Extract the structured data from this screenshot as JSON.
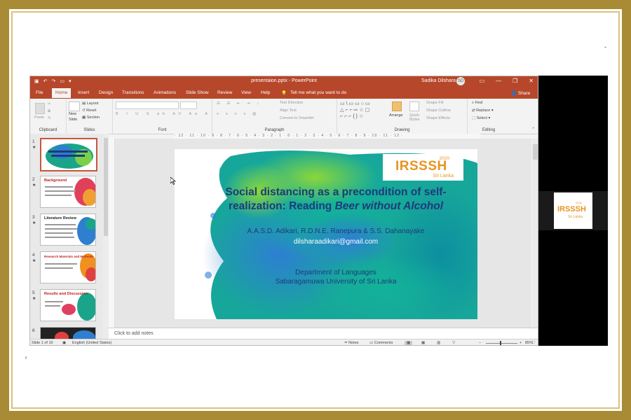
{
  "window": {
    "title": "presentaion.pptx - PowerPoint",
    "user": "Sadika Dilshara",
    "user_initials": "SD",
    "share": "Share",
    "tell_me": "Tell me what you want to do"
  },
  "tabs": [
    "File",
    "Home",
    "Insert",
    "Design",
    "Transitions",
    "Animations",
    "Slide Show",
    "Review",
    "View",
    "Help"
  ],
  "ribbon": {
    "clipboard": {
      "label": "Clipboard",
      "paste": "Paste"
    },
    "slides": {
      "label": "Slides",
      "new_slide": "New",
      "new_slide2": "Slide",
      "layout": "Layout",
      "reset": "Reset",
      "section": "Section"
    },
    "font": {
      "label": "Font"
    },
    "paragraph": {
      "label": "Paragraph",
      "text_direction": "Text Direction",
      "align_text": "Align Text",
      "convert": "Convert to SmartArt"
    },
    "drawing": {
      "label": "Drawing",
      "arrange": "Arrange",
      "quick_styles": "Quick Styles",
      "shape_fill": "Shape Fill",
      "shape_outline": "Shape Outline",
      "shape_effects": "Shape Effects"
    },
    "editing": {
      "label": "Editing",
      "find": "Find",
      "replace": "Replace",
      "select": "Select"
    }
  },
  "slide": {
    "title_line1": "Social distancing as a precondition of self-",
    "title_line2_a": "realization: Reading ",
    "title_line2_b": "Beer without Alcohol",
    "authors": "A.A.S.D. Adikari, R.D.N.E. Ranepura & S.S. Dahanayake",
    "email": "dilsharaadikari@gmail.com",
    "department": "Department of Languages",
    "university": "Sabaragamuwa University of Sri Lanka",
    "logo_year": "2020",
    "logo_name": "IRSSSH",
    "logo_sub": "Sri Lanka"
  },
  "thumbnails": [
    {
      "num": "1",
      "title": ""
    },
    {
      "num": "2",
      "title": "Background"
    },
    {
      "num": "3",
      "title": "Literature Review"
    },
    {
      "num": "4",
      "title": "Research Materials and Methods"
    },
    {
      "num": "5",
      "title": "Results and Discussion"
    },
    {
      "num": "6",
      "title": ""
    }
  ],
  "ruler": "· 12 · 11 · 10 · 9 · 8 · 7 · 6 · 5 · 4 · 3 · 2 · 1 · 0 · 1 · 2 · 3 · 4 · 5 · 6 · 7 · 8 · 9 · 10 · 11 · 12 ·",
  "notes_placeholder": "Click to add notes",
  "status": {
    "slide_count": "Slide 1 of 10",
    "language": "English (United States)",
    "notes": "Notes",
    "comments": "Comments",
    "zoom": "85%"
  },
  "colors": {
    "accent": "#b7472a",
    "slide_title": "#1f3a7a",
    "logo": "#e8941f"
  }
}
